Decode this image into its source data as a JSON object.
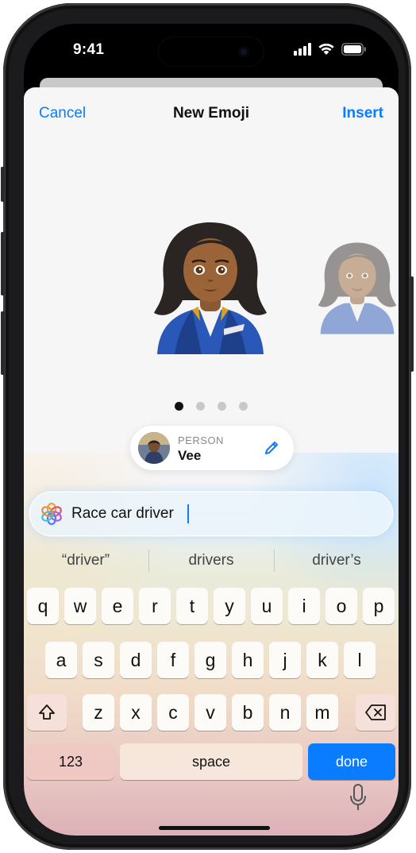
{
  "status": {
    "time": "9:41"
  },
  "nav": {
    "cancel": "Cancel",
    "title": "New Emoji",
    "insert": "Insert"
  },
  "carousel": {
    "pages": 4,
    "active_index": 0
  },
  "person": {
    "type": "PERSON",
    "name": "Vee"
  },
  "prompt": {
    "value": "Race car driver"
  },
  "suggestions": [
    "“driver”",
    "drivers",
    "driver’s"
  ],
  "keyboard": {
    "row1": [
      "q",
      "w",
      "e",
      "r",
      "t",
      "y",
      "u",
      "i",
      "o",
      "p"
    ],
    "row2": [
      "a",
      "s",
      "d",
      "f",
      "g",
      "h",
      "j",
      "k",
      "l"
    ],
    "row3": [
      "z",
      "x",
      "c",
      "v",
      "b",
      "n",
      "m"
    ],
    "numbers": "123",
    "space": "space",
    "done": "done"
  },
  "icons": {
    "shift": "shift-icon",
    "delete": "delete-icon",
    "mic": "microphone-icon",
    "pencil": "pencil-icon",
    "generate": "image-playground-icon"
  },
  "colors": {
    "accent": "#0a7cff",
    "done_key": "#0a7cff"
  }
}
